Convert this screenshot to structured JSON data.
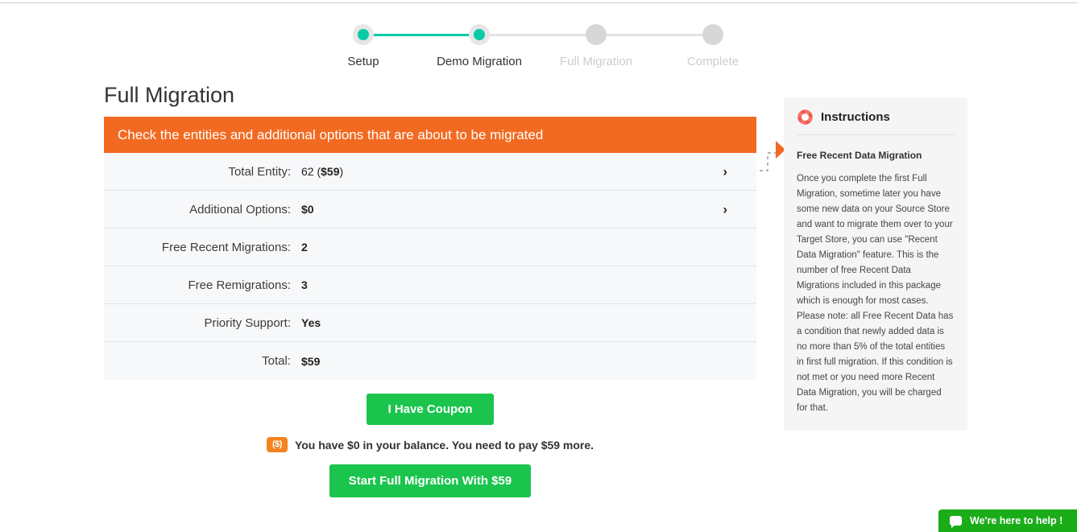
{
  "stepper": {
    "steps": [
      {
        "label": "Setup",
        "state": "done"
      },
      {
        "label": "Demo Migration",
        "state": "done"
      },
      {
        "label": "Full Migration",
        "state": "todo"
      },
      {
        "label": "Complete",
        "state": "todo"
      }
    ],
    "active_color": "#08cba6",
    "inactive_color": "#e3e3e3"
  },
  "page_title": "Full Migration",
  "card": {
    "banner": "Check the entities and additional options that are about to be migrated",
    "banner_color": "#f26a21",
    "rows": [
      {
        "label": "Total Entity:",
        "value_plain": "62 (",
        "value_bold": "$59",
        "value_tail": ")",
        "has_chevron": true
      },
      {
        "label": "Additional Options:",
        "value_bold": "$0",
        "has_chevron": true
      },
      {
        "label": "Free Recent Migrations:",
        "value_bold": "2",
        "has_chevron": false
      },
      {
        "label": "Free Remigrations:",
        "value_bold": "3",
        "has_chevron": false
      },
      {
        "label": "Priority Support:",
        "value_bold": "Yes",
        "has_chevron": false
      },
      {
        "label": "Total:",
        "value_bold": "$59",
        "has_chevron": false
      }
    ]
  },
  "actions": {
    "coupon_label": "I Have Coupon",
    "balance_text": "You have $0 in your balance. You need to pay $59 more.",
    "money_icon_text": "($)",
    "start_label": "Start Full Migration With $59",
    "button_color": "#1bc44d"
  },
  "instructions": {
    "title": "Instructions",
    "subtitle": "Free Recent Data Migration",
    "body": "Once you complete the first Full Migration, sometime later you have some new data on your Source Store and want to migrate them over to your Target Store, you can use \"Recent Data Migration\" feature. This is the number of free Recent Data Migrations included in this package which is enough for most cases. Please note: all Free Recent Data has a condition that newly added data is no more than 5% of the total entities in first full migration. If this condition is not met or you need more Recent Data Migration, you will be charged for that.",
    "panel_color": "#f5f5f5",
    "pointer_color": "#f26a21"
  },
  "chat_widget": {
    "label": "We're here to help !",
    "color": "#1aad19"
  }
}
